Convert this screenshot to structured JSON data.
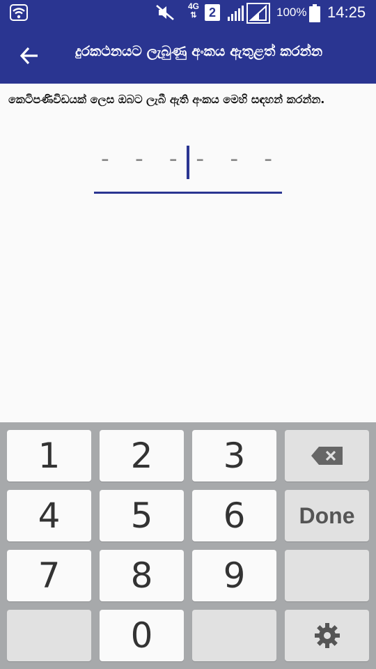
{
  "status_bar": {
    "network": "4G",
    "sim": "2",
    "battery": "100%",
    "time": "14:25",
    "icons": [
      "wifi-icon",
      "mute-icon",
      "signal-icon",
      "signal-icon",
      "battery-icon"
    ]
  },
  "app_bar": {
    "back_icon": "arrow-back-icon",
    "title": "දුරකථනයට ලැබුණු අංකය ඇතුළත් කරන්න",
    "color": "#2a3591"
  },
  "instruction": "කෙටිපණිවිඩයක් ලෙස ඔබට ලැබී ඇති අංකය මෙහි සඳහන් කරන්න.",
  "code_input": {
    "placeholder": "---|---",
    "left_dashes": "- - -",
    "right_dashes": "- - -",
    "accent": "#2a3591"
  },
  "keyboard": {
    "keys": {
      "k1": "1",
      "k2": "2",
      "k3": "3",
      "k4": "4",
      "k5": "5",
      "k6": "6",
      "k7": "7",
      "k8": "8",
      "k9": "9",
      "k0": "0"
    },
    "done_label": "Done",
    "backspace_icon": "backspace-icon",
    "settings_icon": "gear-icon"
  }
}
